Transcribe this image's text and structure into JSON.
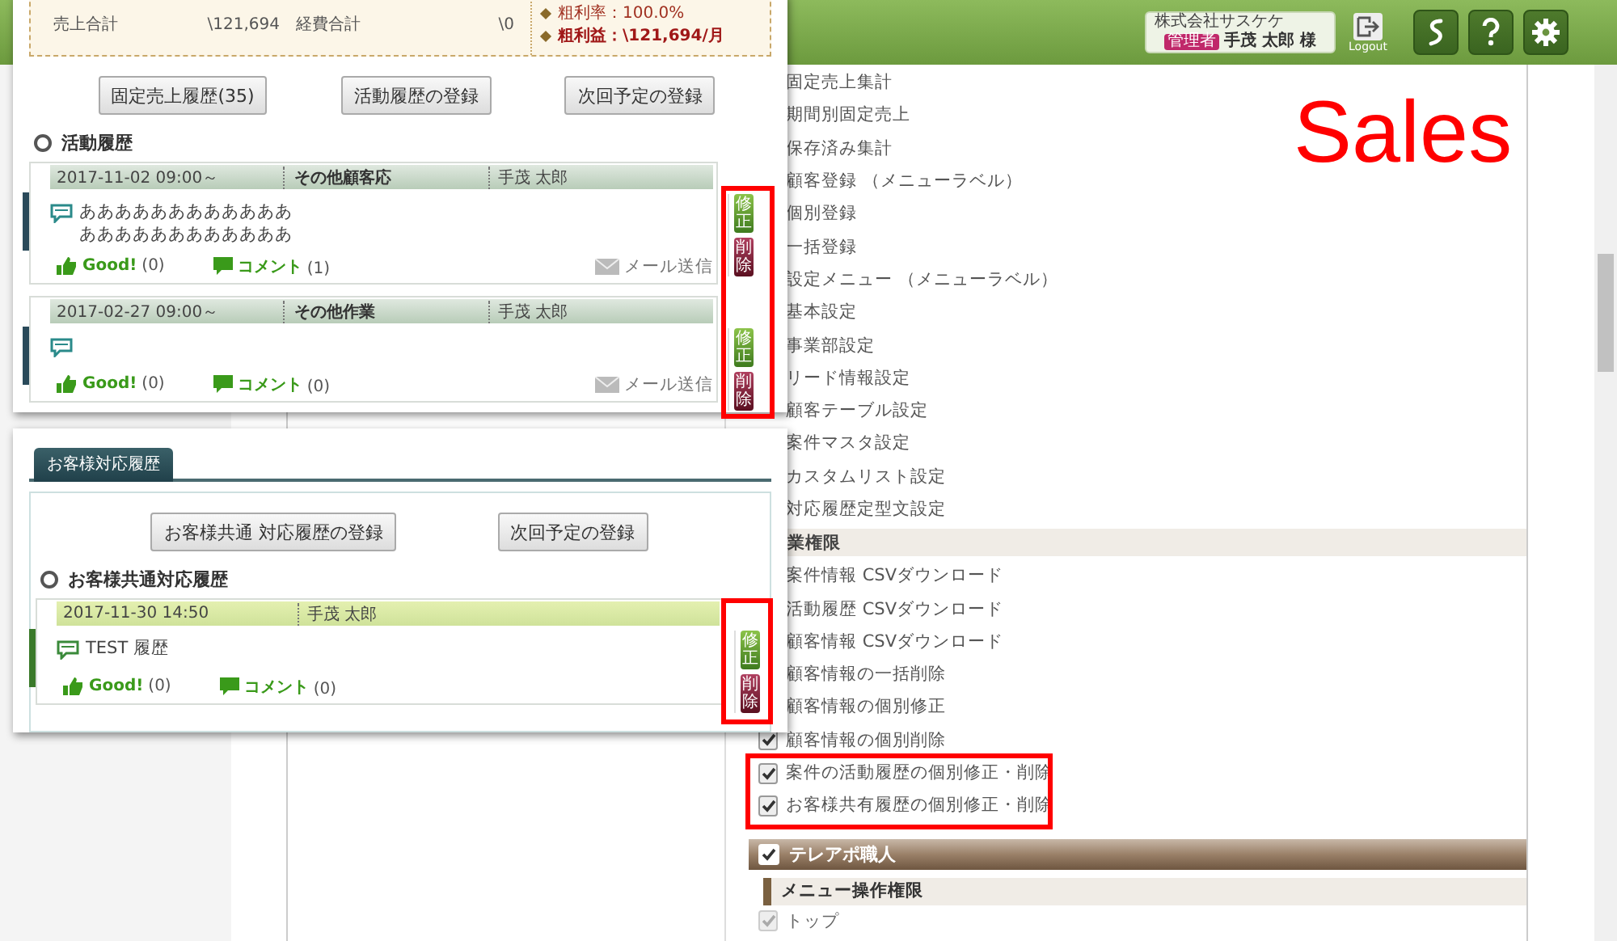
{
  "top_bar": {
    "company": "株式会社サスケケ",
    "role_badge": "管理者",
    "user": "手茂 太郎 様",
    "logout": "Logout"
  },
  "summary": {
    "sales_label": "売上合計",
    "sales_value": "\\121,694",
    "expense_label": "経費合計",
    "expense_value": "\\0",
    "margin_rate": "粗利率：100.0%",
    "gross_profit": "粗利益：\\121,694/月"
  },
  "activity_panel": {
    "buttons": [
      "固定売上履歴(35)",
      "活動履歴の登録",
      "次回予定の登録"
    ],
    "section_title": "活動履歴",
    "entries": [
      {
        "datetime": "2017-11-02 09:00～",
        "type": "その他顧客応",
        "person": "手茂 太郎",
        "body": [
          "ああああああああああああ",
          "ああああああああああああ"
        ],
        "good_label": "Good!",
        "good_count": "(0)",
        "comment_label": "コメント",
        "comment_count": "(1)",
        "mail": "メール送信",
        "edit": "修正",
        "delete": "削除"
      },
      {
        "datetime": "2017-02-27 09:00～",
        "type": "その他作業",
        "person": "手茂 太郎",
        "good_label": "Good!",
        "good_count": "(0)",
        "comment_label": "コメント",
        "comment_count": "(0)",
        "mail": "メール送信",
        "edit": "修正",
        "delete": "削除"
      }
    ]
  },
  "customer_panel": {
    "tab": "お客様対応履歴",
    "buttons": [
      "お客様共通 対応履歴の登録",
      "次回予定の登録"
    ],
    "section_title": "お客様共通対応履歴",
    "entries": [
      {
        "datetime": "2017-11-30 14:50",
        "person": "手茂 太郎",
        "body": "TEST 履歴",
        "good_label": "Good!",
        "good_count": "(0)",
        "comment_label": "コメント",
        "comment_count": "(0)",
        "edit": "修正",
        "delete": "削除"
      }
    ]
  },
  "permission_rows": [
    {
      "kind": "item",
      "label": "固定売上集計"
    },
    {
      "kind": "item",
      "label": "期間別固定売上"
    },
    {
      "kind": "item",
      "label": "保存済み集計"
    },
    {
      "kind": "item",
      "label": "顧客登録 （メニューラベル）"
    },
    {
      "kind": "item",
      "label": "個別登録"
    },
    {
      "kind": "item",
      "label": "一括登録"
    },
    {
      "kind": "item",
      "label": "設定メニュー （メニューラベル）"
    },
    {
      "kind": "item",
      "label": "基本設定"
    },
    {
      "kind": "item",
      "label": "事業部設定"
    },
    {
      "kind": "item",
      "label": "リード情報設定"
    },
    {
      "kind": "item",
      "label": "顧客テーブル設定"
    },
    {
      "kind": "item",
      "label": "案件マスタ設定"
    },
    {
      "kind": "item",
      "label": "カスタムリスト設定"
    },
    {
      "kind": "item",
      "label": "対応履歴定型文設定"
    },
    {
      "kind": "group",
      "label": "業権限"
    },
    {
      "kind": "item",
      "label": "案件情報 CSVダウンロード"
    },
    {
      "kind": "item",
      "label": "活動履歴 CSVダウンロード"
    },
    {
      "kind": "item",
      "label": "顧客情報 CSVダウンロード"
    },
    {
      "kind": "item",
      "label": "顧客情報の一括削除"
    },
    {
      "kind": "item",
      "label": "顧客情報の個別修正"
    },
    {
      "kind": "check",
      "label": "顧客情報の個別削除",
      "checked": true,
      "disabled": false
    },
    {
      "kind": "check",
      "label": "案件の活動履歴の個別修正・削除",
      "checked": true,
      "disabled": false
    },
    {
      "kind": "check",
      "label": "お客様共有履歴の個別修正・削除",
      "checked": true,
      "disabled": false
    },
    {
      "kind": "role",
      "label": "テレアポ職人",
      "checked": true
    },
    {
      "kind": "sub",
      "label": "メニュー操作権限"
    },
    {
      "kind": "check",
      "label": "トップ",
      "checked": true,
      "disabled": true
    }
  ],
  "annotation": "Sales"
}
